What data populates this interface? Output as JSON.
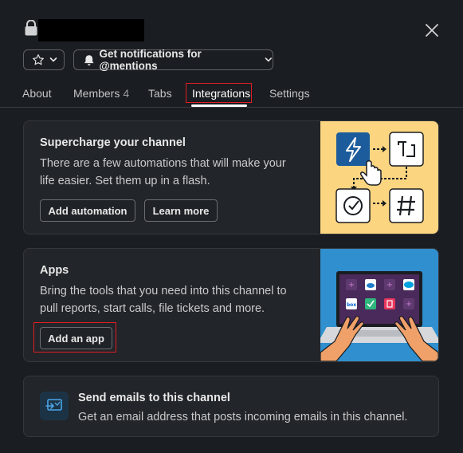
{
  "header": {
    "notifications_label": "Get notifications for @mentions"
  },
  "tabs": [
    {
      "label": "About"
    },
    {
      "label": "Members",
      "count": "4"
    },
    {
      "label": "Tabs"
    },
    {
      "label": "Integrations",
      "active": true
    },
    {
      "label": "Settings"
    }
  ],
  "automations": {
    "title": "Supercharge your channel",
    "description": "There are a few automations that will make your life easier. Set them up in a flash.",
    "add_button": "Add automation",
    "learn_button": "Learn more"
  },
  "apps": {
    "title": "Apps",
    "description": "Bring the tools that you need into this channel to pull reports, start calls, file tickets and more.",
    "add_button": "Add an app"
  },
  "email": {
    "title": "Send emails to this channel",
    "description": "Get an email address that posts incoming emails in this channel."
  },
  "colors": {
    "background": "#1a1d21",
    "card": "#222529",
    "highlight": "#e01e24",
    "automation_illustration": "#fcd581",
    "apps_illustration": "#2f8fcf"
  }
}
